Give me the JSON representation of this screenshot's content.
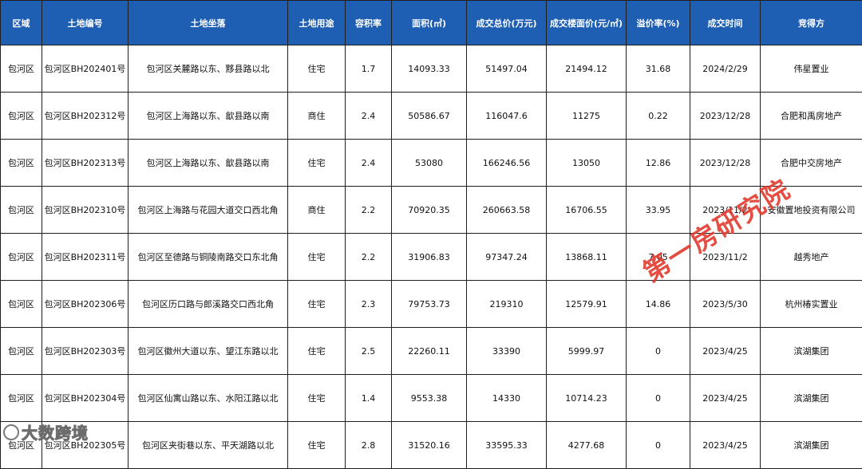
{
  "table": {
    "headers": [
      "区域",
      "土地编号",
      "土地坐落",
      "土地用途",
      "容积率",
      "面积(㎡)",
      "成交总价(万元)",
      "成交楼面价(元/㎡)",
      "溢价率(%)",
      "成交时间",
      "竞得方"
    ],
    "header_color": "#1f5fb3",
    "rows": [
      [
        "包河区",
        "包河区BH202401号",
        "包河区关麓路以东、黟县路以北",
        "住宅",
        "1.7",
        "14093.33",
        "51497.04",
        "21494.12",
        "31.68",
        "2024/2/29",
        "伟星置业"
      ],
      [
        "包河区",
        "包河区BH202312号",
        "包河区上海路以东、歙县路以南",
        "商住",
        "2.4",
        "50586.67",
        "116047.6",
        "11275",
        "0.22",
        "2023/12/28",
        "合肥和禹房地产"
      ],
      [
        "包河区",
        "包河区BH202313号",
        "包河区上海路以东、歙县路以南",
        "住宅",
        "2.4",
        "53080",
        "166246.56",
        "13050",
        "12.86",
        "2023/12/28",
        "合肥中交房地产"
      ],
      [
        "包河区",
        "包河区BH202310号",
        "包河区上海路与花园大道交口西北角",
        "商住",
        "2.2",
        "70920.35",
        "260663.58",
        "16706.55",
        "33.95",
        "2023/11/2",
        "安徽置地投资有限公司"
      ],
      [
        "包河区",
        "包河区BH202311号",
        "包河区至德路与铜陵南路交口东北角",
        "住宅",
        "2.2",
        "31906.83",
        "97347.24",
        "13868.11",
        "7.05",
        "2023/11/2",
        "越秀地产"
      ],
      [
        "包河区",
        "包河区BH202306号",
        "包河区历口路与郎溪路交口西北角",
        "住宅",
        "2.3",
        "79753.73",
        "219310",
        "12579.91",
        "14.86",
        "2023/5/30",
        "杭州椿实置业"
      ],
      [
        "包河区",
        "包河区BH202303号",
        "包河区徽州大道以东、望江东路以北",
        "住宅",
        "2.5",
        "22260.11",
        "33390",
        "5999.97",
        "0",
        "2023/4/25",
        "滨湖集团"
      ],
      [
        "包河区",
        "包河区BH202304号",
        "包河区仙寓山路以东、水阳江路以北",
        "住宅",
        "1.4",
        "9553.38",
        "14330",
        "10714.23",
        "0",
        "2023/4/25",
        "滨湖集团"
      ],
      [
        "包河区",
        "包河区BH202305号",
        "包河区夹街巷以东、平天湖路以北",
        "住宅",
        "2.8",
        "31520.16",
        "33595.33",
        "4277.68",
        "0",
        "2023/4/25",
        "滨湖集团"
      ]
    ]
  },
  "watermark": {
    "text": "第一房研究院",
    "color": "#e23b2e"
  },
  "corner_logo": {
    "text": "大数跨境",
    "icon": "logo-mark-icon"
  }
}
